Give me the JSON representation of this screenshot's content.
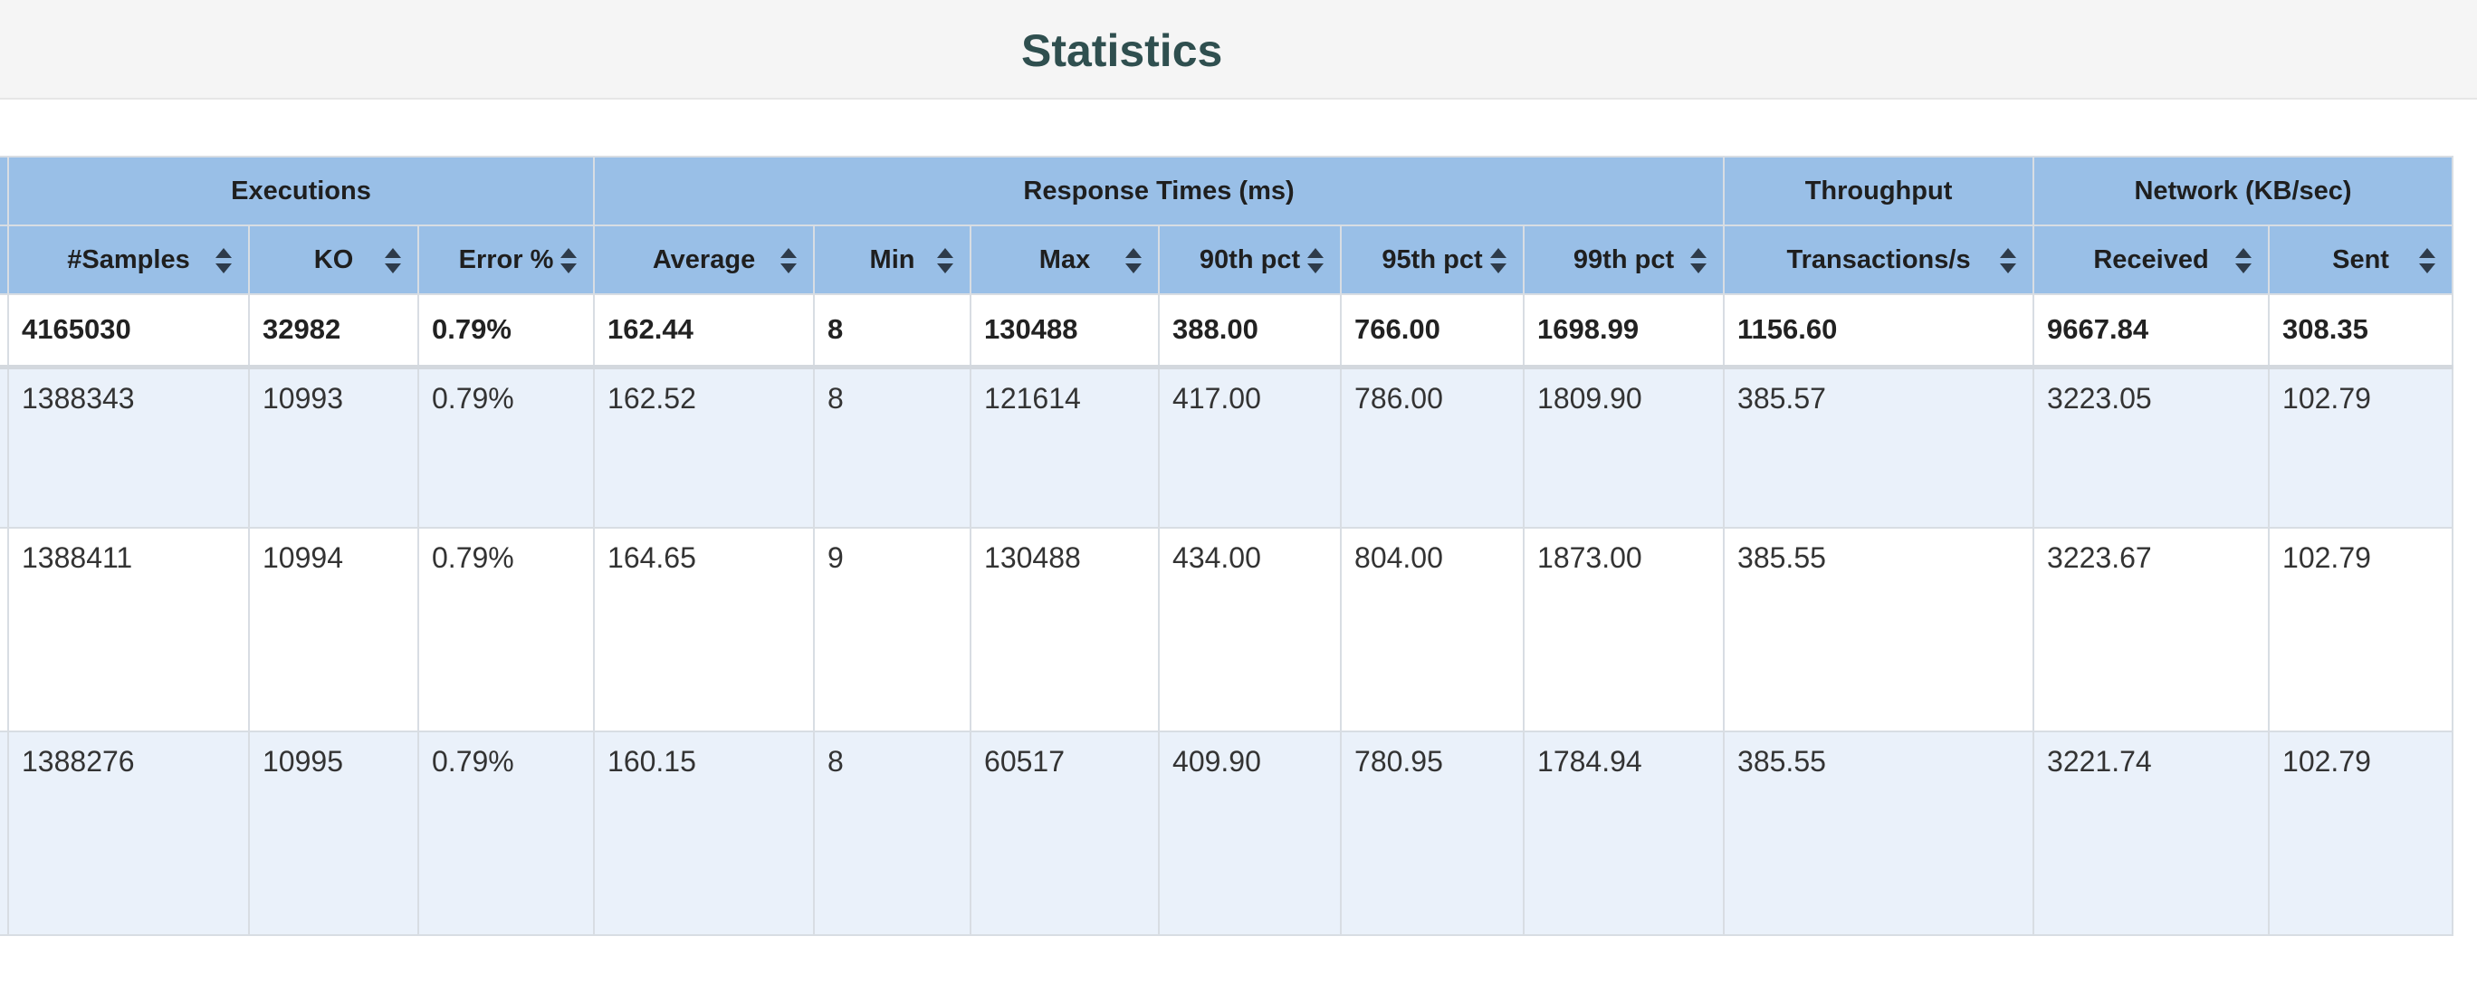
{
  "page": {
    "title": "Statistics"
  },
  "table": {
    "groups": {
      "executions": "Executions",
      "response_times": "Response Times (ms)",
      "throughput": "Throughput",
      "network": "Network (KB/sec)"
    },
    "columns": {
      "samples": "#Samples",
      "ko": "KO",
      "error_pct": "Error %",
      "average": "Average",
      "min": "Min",
      "max": "Max",
      "p90": "90th pct",
      "p95": "95th pct",
      "p99": "99th pct",
      "transactions": "Transactions/s",
      "received": "Received",
      "sent": "Sent"
    },
    "total": {
      "samples": "4165030",
      "ko": "32982",
      "error_pct": "0.79%",
      "average": "162.44",
      "min": "8",
      "max": "130488",
      "p90": "388.00",
      "p95": "766.00",
      "p99": "1698.99",
      "transactions": "1156.60",
      "received": "9667.84",
      "sent": "308.35"
    },
    "rows": [
      {
        "samples": "1388343",
        "ko": "10993",
        "error_pct": "0.79%",
        "average": "162.52",
        "min": "8",
        "max": "121614",
        "p90": "417.00",
        "p95": "786.00",
        "p99": "1809.90",
        "transactions": "385.57",
        "received": "3223.05",
        "sent": "102.79"
      },
      {
        "samples": "1388411",
        "ko": "10994",
        "error_pct": "0.79%",
        "average": "164.65",
        "min": "9",
        "max": "130488",
        "p90": "434.00",
        "p95": "804.00",
        "p99": "1873.00",
        "transactions": "385.55",
        "received": "3223.67",
        "sent": "102.79"
      },
      {
        "samples": "1388276",
        "ko": "10995",
        "error_pct": "0.79%",
        "average": "160.15",
        "min": "8",
        "max": "60517",
        "p90": "409.90",
        "p95": "780.95",
        "p99": "1784.94",
        "transactions": "385.55",
        "received": "3221.74",
        "sent": "102.79"
      }
    ]
  }
}
